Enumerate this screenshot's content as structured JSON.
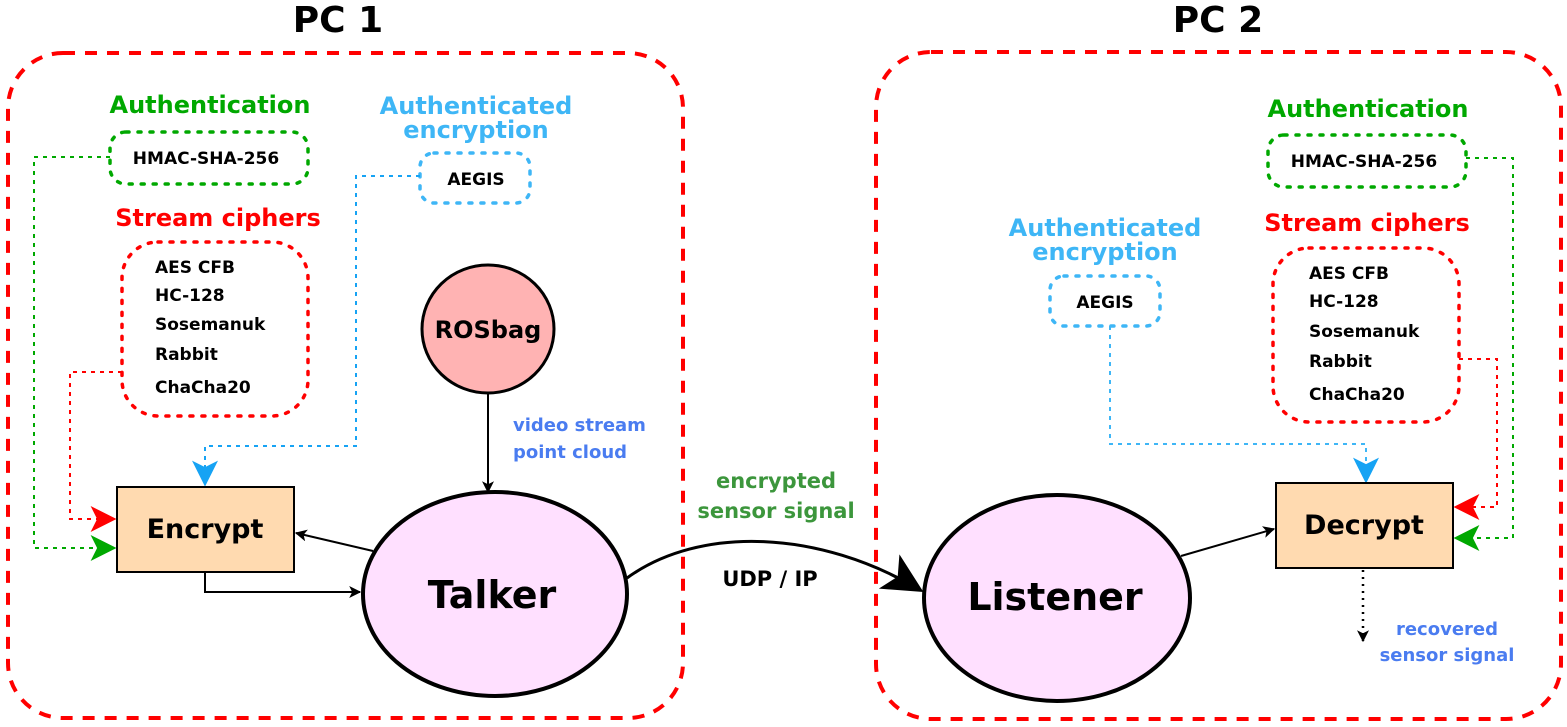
{
  "colors": {
    "pc_border": "#ff0000",
    "authentication": "#00a800",
    "authenticated_encryption": "#3eb6f6",
    "stream_ciphers": "#ff0000",
    "rosbag_fill": "#ffb3b3",
    "ros_node_fill": "#ffe0ff",
    "crypto_box_fill": "#ffdab0",
    "signal_note_blue": "#4a7cf0",
    "signal_note_green": "#3c963c"
  },
  "pc1": {
    "title": "PC 1",
    "authentication": {
      "heading": "Authentication",
      "algorithms": [
        "HMAC-SHA-256"
      ]
    },
    "authenticated_encryption": {
      "heading_line1": "Authenticated",
      "heading_line2": "encryption",
      "algorithms": [
        "AEGIS"
      ]
    },
    "stream_ciphers": {
      "heading": "Stream ciphers",
      "algorithms": [
        "AES CFB",
        "HC-128",
        "Sosemanuk",
        "Rabbit",
        "ChaCha20"
      ]
    },
    "rosbag": {
      "label": "ROSbag"
    },
    "rosbag_output": {
      "line1": "video stream",
      "line2": "point cloud"
    },
    "encrypt": {
      "label": "Encrypt"
    },
    "talker": {
      "label": "Talker"
    }
  },
  "link": {
    "payload_line1": "encrypted",
    "payload_line2": "sensor signal",
    "protocol": "UDP / IP"
  },
  "pc2": {
    "title": "PC 2",
    "authentication": {
      "heading": "Authentication",
      "algorithms": [
        "HMAC-SHA-256"
      ]
    },
    "authenticated_encryption": {
      "heading_line1": "Authenticated",
      "heading_line2": "encryption",
      "algorithms": [
        "AEGIS"
      ]
    },
    "stream_ciphers": {
      "heading": "Stream ciphers",
      "algorithms": [
        "AES CFB",
        "HC-128",
        "Sosemanuk",
        "Rabbit",
        "ChaCha20"
      ]
    },
    "listener": {
      "label": "Listener"
    },
    "decrypt": {
      "label": "Decrypt"
    },
    "decrypt_output": {
      "line1": "recovered",
      "line2": "sensor signal"
    }
  }
}
